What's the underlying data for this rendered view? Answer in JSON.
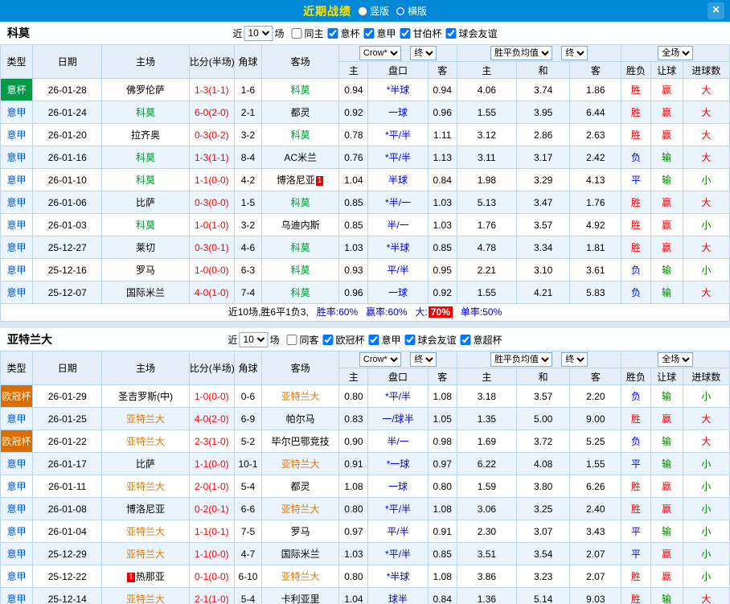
{
  "titlebar": {
    "title": "近期战绩",
    "radios": [
      {
        "label": "竖版",
        "selected": false
      },
      {
        "label": "横版",
        "selected": true
      }
    ],
    "close_label": "×"
  },
  "colors": {
    "titlebar_bg": "#0189d8",
    "title_text": "#ffe400",
    "score_red": "#ff0000",
    "handicap_blue": "#0000d8",
    "win_red": "#ff0000",
    "draw_loss_blue": "#0000ff",
    "lose_green": "#088000",
    "cup_green_bg": "#029a46",
    "league_blue": "#0057c8",
    "cup_orange_bg": "#dc6e00"
  },
  "table_header": {
    "type": "类型",
    "date": "日期",
    "home": "主场",
    "score": "比分(半场)",
    "corner": "角球",
    "away": "客场",
    "bookmaker": "Crow*",
    "final_a": "终",
    "o_home": "主",
    "o_handicap": "盘口",
    "o_away": "客",
    "avg": "胜平负均值",
    "final_b": "终",
    "e_home": "主",
    "e_draw": "和",
    "e_away": "客",
    "fulltime": "全场",
    "r_outcome": "胜负",
    "r_handicap": "让球",
    "r_goals": "进球数"
  },
  "sections": [
    {
      "team": "科莫",
      "team_color": "#009933",
      "near": "近",
      "count": "10",
      "games": "场",
      "filters": [
        {
          "label": "同主",
          "checked": false
        },
        {
          "label": "意杯",
          "checked": true
        },
        {
          "label": "意甲",
          "checked": true
        },
        {
          "label": "甘伯杯",
          "checked": true
        },
        {
          "label": "球会友谊",
          "checked": true
        }
      ],
      "rows": [
        {
          "league": "意杯",
          "ls": "green",
          "date": "26-01-28",
          "home": "佛罗伦萨",
          "away": "科莫",
          "away_hl": true,
          "score": "1-3(1-1)",
          "corners": "1-6",
          "odds": [
            "0.94",
            "*半球",
            "0.94"
          ],
          "europe": [
            "4.06",
            "3.74",
            "1.86"
          ],
          "res": [
            [
              "胜",
              "r"
            ],
            [
              "赢",
              "r"
            ],
            [
              "大",
              "r"
            ]
          ]
        },
        {
          "league": "意甲",
          "ls": "blue",
          "date": "26-01-24",
          "home": "科莫",
          "home_hl": true,
          "away": "都灵",
          "score": "6-0(2-0)",
          "corners": "2-1",
          "odds": [
            "0.92",
            "一球",
            "0.96"
          ],
          "europe": [
            "1.55",
            "3.95",
            "6.44"
          ],
          "res": [
            [
              "胜",
              "r"
            ],
            [
              "赢",
              "r"
            ],
            [
              "大",
              "r"
            ]
          ]
        },
        {
          "league": "意甲",
          "ls": "blue",
          "date": "26-01-20",
          "home": "拉齐奥",
          "away": "科莫",
          "away_hl": true,
          "score": "0-3(0-2)",
          "corners": "3-2",
          "odds": [
            "0.78",
            "*平/半",
            "1.11"
          ],
          "europe": [
            "3.12",
            "2.86",
            "2.63"
          ],
          "res": [
            [
              "胜",
              "r"
            ],
            [
              "赢",
              "r"
            ],
            [
              "大",
              "r"
            ]
          ]
        },
        {
          "league": "意甲",
          "ls": "blue",
          "date": "26-01-16",
          "home": "科莫",
          "home_hl": true,
          "away": "AC米兰",
          "score": "1-3(1-1)",
          "corners": "8-4",
          "odds": [
            "0.76",
            "*平/半",
            "1.13"
          ],
          "europe": [
            "3.11",
            "3.17",
            "2.42"
          ],
          "res": [
            [
              "负",
              "b"
            ],
            [
              "输",
              "g"
            ],
            [
              "大",
              "r"
            ]
          ]
        },
        {
          "league": "意甲",
          "ls": "blue",
          "date": "26-01-10",
          "home": "科莫",
          "home_hl": true,
          "away": "博洛尼亚",
          "away_badge": "1",
          "away_badge_pos": "after",
          "score": "1-1(0-0)",
          "corners": "4-2",
          "odds": [
            "1.04",
            "半球",
            "0.84"
          ],
          "europe": [
            "1.98",
            "3.29",
            "4.13"
          ],
          "res": [
            [
              "平",
              "b"
            ],
            [
              "输",
              "g"
            ],
            [
              "小",
              "g"
            ]
          ]
        },
        {
          "league": "意甲",
          "ls": "blue",
          "date": "26-01-06",
          "home": "比萨",
          "away": "科莫",
          "away_hl": true,
          "score": "0-3(0-0)",
          "corners": "1-5",
          "odds": [
            "0.85",
            "*半/一",
            "1.03"
          ],
          "europe": [
            "5.13",
            "3.47",
            "1.76"
          ],
          "res": [
            [
              "胜",
              "r"
            ],
            [
              "赢",
              "r"
            ],
            [
              "大",
              "r"
            ]
          ]
        },
        {
          "league": "意甲",
          "ls": "blue",
          "date": "26-01-03",
          "home": "科莫",
          "home_hl": true,
          "away": "乌迪内斯",
          "score": "1-0(1-0)",
          "corners": "3-2",
          "odds": [
            "0.85",
            "半/一",
            "1.03"
          ],
          "europe": [
            "1.76",
            "3.57",
            "4.92"
          ],
          "res": [
            [
              "胜",
              "r"
            ],
            [
              "赢",
              "r"
            ],
            [
              "小",
              "g"
            ]
          ]
        },
        {
          "league": "意甲",
          "ls": "blue",
          "date": "25-12-27",
          "home": "莱切",
          "away": "科莫",
          "away_hl": true,
          "score": "0-3(0-1)",
          "corners": "4-6",
          "odds": [
            "1.03",
            "*半球",
            "0.85"
          ],
          "europe": [
            "4.78",
            "3.34",
            "1.81"
          ],
          "res": [
            [
              "胜",
              "r"
            ],
            [
              "赢",
              "r"
            ],
            [
              "大",
              "r"
            ]
          ]
        },
        {
          "league": "意甲",
          "ls": "blue",
          "date": "25-12-16",
          "home": "罗马",
          "away": "科莫",
          "away_hl": true,
          "score": "1-0(0-0)",
          "corners": "6-3",
          "odds": [
            "0.93",
            "平/半",
            "0.95"
          ],
          "europe": [
            "2.21",
            "3.10",
            "3.61"
          ],
          "res": [
            [
              "负",
              "b"
            ],
            [
              "输",
              "g"
            ],
            [
              "小",
              "g"
            ]
          ]
        },
        {
          "league": "意甲",
          "ls": "blue",
          "date": "25-12-07",
          "home": "国际米兰",
          "away": "科莫",
          "away_hl": true,
          "score": "4-0(1-0)",
          "corners": "7-4",
          "odds": [
            "0.96",
            "一球",
            "0.92"
          ],
          "europe": [
            "1.55",
            "4.21",
            "5.83"
          ],
          "res": [
            [
              "负",
              "b"
            ],
            [
              "输",
              "g"
            ],
            [
              "大",
              "r"
            ]
          ]
        }
      ],
      "summary": [
        {
          "text": "近10场,胜6平1负3,",
          "cls": "sum-plain"
        },
        {
          "text": "胜率:60%",
          "cls": "sum-blue"
        },
        {
          "text": "赢率:60%",
          "cls": "sum-blue"
        },
        {
          "text": "大:",
          "cls": "sum-blue sum-tight"
        },
        {
          "text": "70%",
          "cls": "sum-red"
        },
        {
          "text": "单率:50%",
          "cls": "sum-blue"
        }
      ]
    },
    {
      "team": "亚特兰大",
      "team_color": "#e07800",
      "near": "近",
      "count": "10",
      "games": "场",
      "filters": [
        {
          "label": "同客",
          "checked": false
        },
        {
          "label": "欧冠杯",
          "checked": true
        },
        {
          "label": "意甲",
          "checked": true
        },
        {
          "label": "球会友谊",
          "checked": true
        },
        {
          "label": "意超杯",
          "checked": true
        }
      ],
      "rows": [
        {
          "league": "欧冠杯",
          "ls": "orange",
          "date": "26-01-29",
          "home": "圣吉罗斯(中)",
          "away": "亚特兰大",
          "away_hl": true,
          "score": "1-0(0-0)",
          "corners": "0-6",
          "odds": [
            "0.80",
            "*平/半",
            "1.08"
          ],
          "europe": [
            "3.18",
            "3.57",
            "2.20"
          ],
          "res": [
            [
              "负",
              "b"
            ],
            [
              "输",
              "g"
            ],
            [
              "小",
              "g"
            ]
          ]
        },
        {
          "league": "意甲",
          "ls": "blue",
          "date": "26-01-25",
          "home": "亚特兰大",
          "home_hl": true,
          "away": "帕尔马",
          "score": "4-0(2-0)",
          "corners": "6-9",
          "odds": [
            "0.83",
            "一/球半",
            "1.05"
          ],
          "europe": [
            "1.35",
            "5.00",
            "9.00"
          ],
          "res": [
            [
              "胜",
              "r"
            ],
            [
              "赢",
              "r"
            ],
            [
              "大",
              "r"
            ]
          ]
        },
        {
          "league": "欧冠杯",
          "ls": "orange",
          "date": "26-01-22",
          "home": "亚特兰大",
          "home_hl": true,
          "away": "毕尔巴鄂竞技",
          "score": "2-3(1-0)",
          "corners": "5-2",
          "odds": [
            "0.90",
            "半/一",
            "0.98"
          ],
          "europe": [
            "1.69",
            "3.72",
            "5.25"
          ],
          "res": [
            [
              "负",
              "b"
            ],
            [
              "输",
              "g"
            ],
            [
              "大",
              "r"
            ]
          ]
        },
        {
          "league": "意甲",
          "ls": "blue",
          "date": "26-01-17",
          "home": "比萨",
          "away": "亚特兰大",
          "away_hl": true,
          "score": "1-1(0-0)",
          "corners": "10-1",
          "odds": [
            "0.91",
            "*一球",
            "0.97"
          ],
          "europe": [
            "6.22",
            "4.08",
            "1.55"
          ],
          "res": [
            [
              "平",
              "b"
            ],
            [
              "输",
              "g"
            ],
            [
              "小",
              "g"
            ]
          ]
        },
        {
          "league": "意甲",
          "ls": "blue",
          "date": "26-01-11",
          "home": "亚特兰大",
          "home_hl": true,
          "away": "都灵",
          "score": "2-0(1-0)",
          "corners": "5-4",
          "odds": [
            "1.08",
            "一球",
            "0.80"
          ],
          "europe": [
            "1.59",
            "3.80",
            "6.26"
          ],
          "res": [
            [
              "胜",
              "r"
            ],
            [
              "赢",
              "r"
            ],
            [
              "小",
              "g"
            ]
          ]
        },
        {
          "league": "意甲",
          "ls": "blue",
          "date": "26-01-08",
          "home": "博洛尼亚",
          "away": "亚特兰大",
          "away_hl": true,
          "score": "0-2(0-1)",
          "corners": "6-6",
          "odds": [
            "0.80",
            "*平/半",
            "1.08"
          ],
          "europe": [
            "3.06",
            "3.25",
            "2.40"
          ],
          "res": [
            [
              "胜",
              "r"
            ],
            [
              "赢",
              "r"
            ],
            [
              "小",
              "g"
            ]
          ]
        },
        {
          "league": "意甲",
          "ls": "blue",
          "date": "26-01-04",
          "home": "亚特兰大",
          "home_hl": true,
          "away": "罗马",
          "score": "1-1(0-1)",
          "corners": "7-5",
          "odds": [
            "0.97",
            "平/半",
            "0.91"
          ],
          "europe": [
            "2.30",
            "3.07",
            "3.43"
          ],
          "res": [
            [
              "平",
              "b"
            ],
            [
              "输",
              "g"
            ],
            [
              "小",
              "g"
            ]
          ]
        },
        {
          "league": "意甲",
          "ls": "blue",
          "date": "25-12-29",
          "home": "亚特兰大",
          "home_hl": true,
          "away": "国际米兰",
          "score": "1-1(0-0)",
          "corners": "4-7",
          "odds": [
            "1.03",
            "*平/半",
            "0.85"
          ],
          "europe": [
            "3.51",
            "3.54",
            "2.07"
          ],
          "res": [
            [
              "平",
              "b"
            ],
            [
              "赢",
              "r"
            ],
            [
              "小",
              "g"
            ]
          ]
        },
        {
          "league": "意甲",
          "ls": "blue",
          "date": "25-12-22",
          "home": "热那亚",
          "home_badge": "1",
          "home_badge_pos": "before",
          "away": "亚特兰大",
          "away_hl": true,
          "score": "0-1(0-0)",
          "corners": "6-10",
          "odds": [
            "0.80",
            "*半球",
            "1.08"
          ],
          "europe": [
            "3.86",
            "3.23",
            "2.07"
          ],
          "res": [
            [
              "胜",
              "r"
            ],
            [
              "赢",
              "r"
            ],
            [
              "小",
              "g"
            ]
          ]
        },
        {
          "league": "意甲",
          "ls": "blue",
          "date": "25-12-14",
          "home": "亚特兰大",
          "home_hl": true,
          "away": "卡利亚里",
          "score": "2-1(1-0)",
          "corners": "5-4",
          "odds": [
            "1.04",
            "球半",
            "0.84"
          ],
          "europe": [
            "1.36",
            "5.14",
            "9.03"
          ],
          "res": [
            [
              "胜",
              "r"
            ],
            [
              "输",
              "g"
            ],
            [
              "大",
              "r"
            ]
          ]
        }
      ]
    }
  ]
}
